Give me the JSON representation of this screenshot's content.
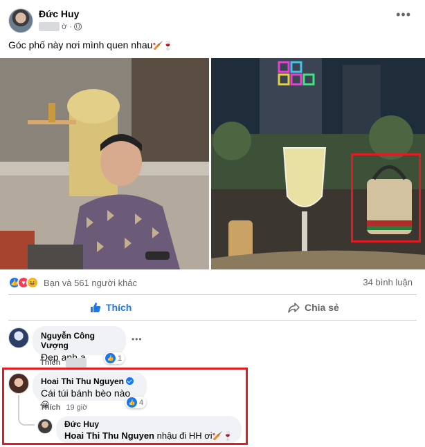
{
  "post": {
    "author": "Đức Huy",
    "time_suffix": "ờ ·",
    "text": "Góc phố này nơi mình quen nhau",
    "text_emoji": "🏏🍷",
    "more_label": "•••"
  },
  "reactions": {
    "summary": "Bạn và 561 người khác",
    "comments": "34 bình luận",
    "icons": [
      "like-icon",
      "love-icon",
      "haha-icon"
    ]
  },
  "actions": {
    "like_label": "Thích",
    "share_label": "Chia sẻ"
  },
  "comments": [
    {
      "name": "Nguyễn Công Vượng",
      "text": "Đẹp anh ạ",
      "like_label": "Thích",
      "time": "",
      "reaction_count": "1",
      "more_label": "•••"
    },
    {
      "name": "Hoai Thi Thu Nguyen",
      "text": "Cái túi bánh bèo nào",
      "emoji": "😀",
      "like_label": "Thích",
      "time": "19 giờ",
      "reaction_count": "4"
    },
    {
      "name": "Đức Huy",
      "mention": "Hoai Thi Thu Nguyen",
      "text": "nhậu đi HH ơi",
      "emoji": "🏏🍷"
    }
  ],
  "colors": {
    "brand": "#1877f2",
    "highlight": "#e11b22",
    "bubble": "#f0f2f5",
    "muted": "#65676b"
  }
}
